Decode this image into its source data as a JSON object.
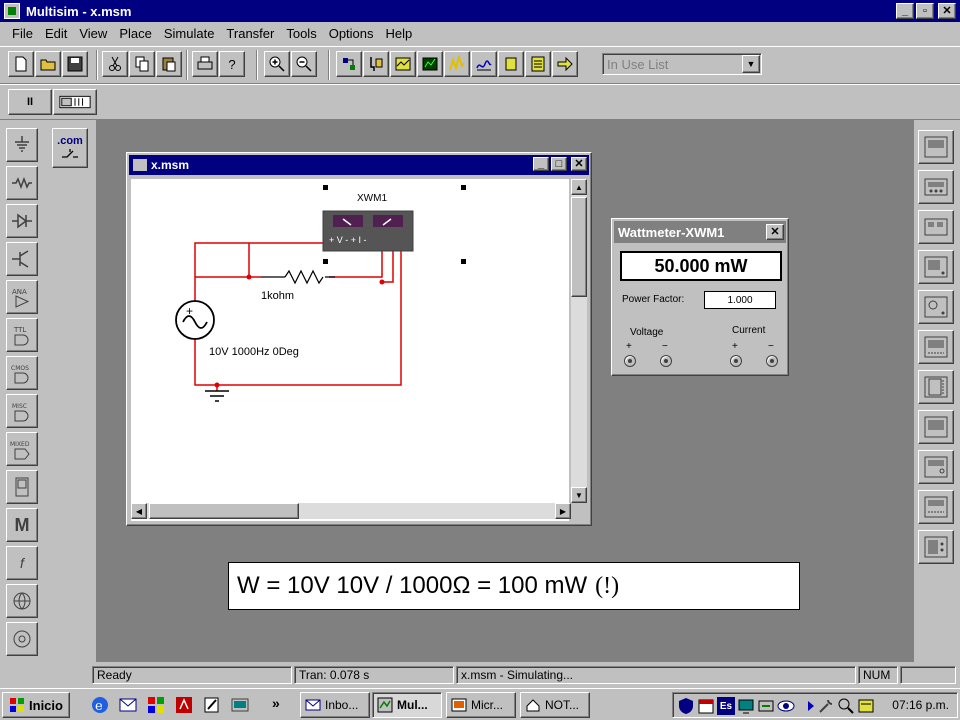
{
  "window": {
    "title": "Multisim - x.msm",
    "minimize": "_",
    "maximize": "▫",
    "close": "✕"
  },
  "menu": [
    "File",
    "Edit",
    "View",
    "Place",
    "Simulate",
    "Transfer",
    "Tools",
    "Options",
    "Help"
  ],
  "toolbar": {
    "help_glyph": "?",
    "in_use_list": "In Use List",
    "pause_glyph": "II"
  },
  "leftbin": {
    "com_label": ".com",
    "ana_label": "ANA",
    "ttl_label": "TTL",
    "cmos_label": "CMOS",
    "misc_label": "MISC",
    "mixed_label": "MIXED",
    "m_label": "M",
    "f_label": "f"
  },
  "circuit": {
    "window_title": "x.msm",
    "meter_label": "XWM1",
    "meter_terminals": "+ V -    + I -",
    "resistor_label": "1kohm",
    "source_label": "10V 1000Hz 0Deg"
  },
  "wattmeter": {
    "title": "Wattmeter-XWM1",
    "reading": "50.000 mW",
    "pf_label": "Power Factor:",
    "pf_value": "1.000",
    "voltage_label": "Voltage",
    "current_label": "Current",
    "plus": "+",
    "minus": "−"
  },
  "note": {
    "formula": "W = 10V 10V / 1000Ω = 100 mW",
    "exclaim": "(!)"
  },
  "status": {
    "ready": "Ready",
    "tran": "Tran: 0.078 s",
    "sim": "x.msm - Simulating...",
    "num": "NUM"
  },
  "taskbar": {
    "start": "Inicio",
    "more": "»",
    "tasks": [
      "Inbo...",
      "Mul...",
      "Micr...",
      "NOT..."
    ],
    "clock": "07:16 p.m.",
    "lang": "Es"
  },
  "colors": {
    "title_active": "#000080",
    "wire": "#e00000",
    "meter_face": "#555555"
  }
}
